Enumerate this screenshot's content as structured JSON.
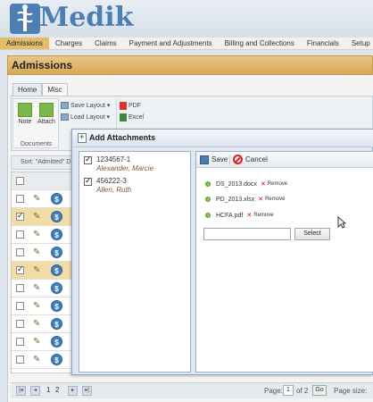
{
  "app": {
    "logo_text": "Medik"
  },
  "nav": [
    "Admissions",
    "Charges",
    "Claims",
    "Payment and Adjustments",
    "Billing and Collections",
    "Financials",
    "Setup"
  ],
  "page_title": "Admissions",
  "ribbon": {
    "tabs": [
      "Home",
      "Misc"
    ],
    "active_tab": "Misc",
    "note_label": "Note",
    "attach_label": "Attach",
    "documents_label": "Documents",
    "save_layout_label": "Save Layout",
    "load_layout_label": "Load Layout",
    "pdf_label": "PDF",
    "excel_label": "Excel"
  },
  "sort_text": "Sort: \"Admitted\" D",
  "grid_rows": [
    {
      "checked": false,
      "highlight": false
    },
    {
      "checked": true,
      "highlight": true
    },
    {
      "checked": false,
      "highlight": false
    },
    {
      "checked": false,
      "highlight": false
    },
    {
      "checked": true,
      "highlight": true
    },
    {
      "checked": false,
      "highlight": false
    },
    {
      "checked": false,
      "highlight": false
    },
    {
      "checked": false,
      "highlight": false
    },
    {
      "checked": false,
      "highlight": false
    },
    {
      "checked": false,
      "highlight": false
    }
  ],
  "pager": {
    "pages": [
      "1",
      "2"
    ],
    "page_label": "Page:",
    "current_page": "1",
    "of_label": "of 2",
    "go_label": "Go",
    "page_size_label": "Page size:"
  },
  "dialog": {
    "title": "Add Attachments",
    "patients": [
      {
        "id": "1234567-1",
        "name": "Alexander, Marcie",
        "checked": true
      },
      {
        "id": "456222-3",
        "name": "Allen, Ruth",
        "checked": true
      }
    ],
    "save_label": "Save",
    "cancel_label": "Cancel",
    "files": [
      {
        "name": "DS_2013.docx",
        "remove_label": "Remove"
      },
      {
        "name": "PD_2013.xlsx",
        "remove_label": "Remove"
      },
      {
        "name": "HCFA.pdf",
        "remove_label": "Remove"
      }
    ],
    "select_label": "Select"
  }
}
